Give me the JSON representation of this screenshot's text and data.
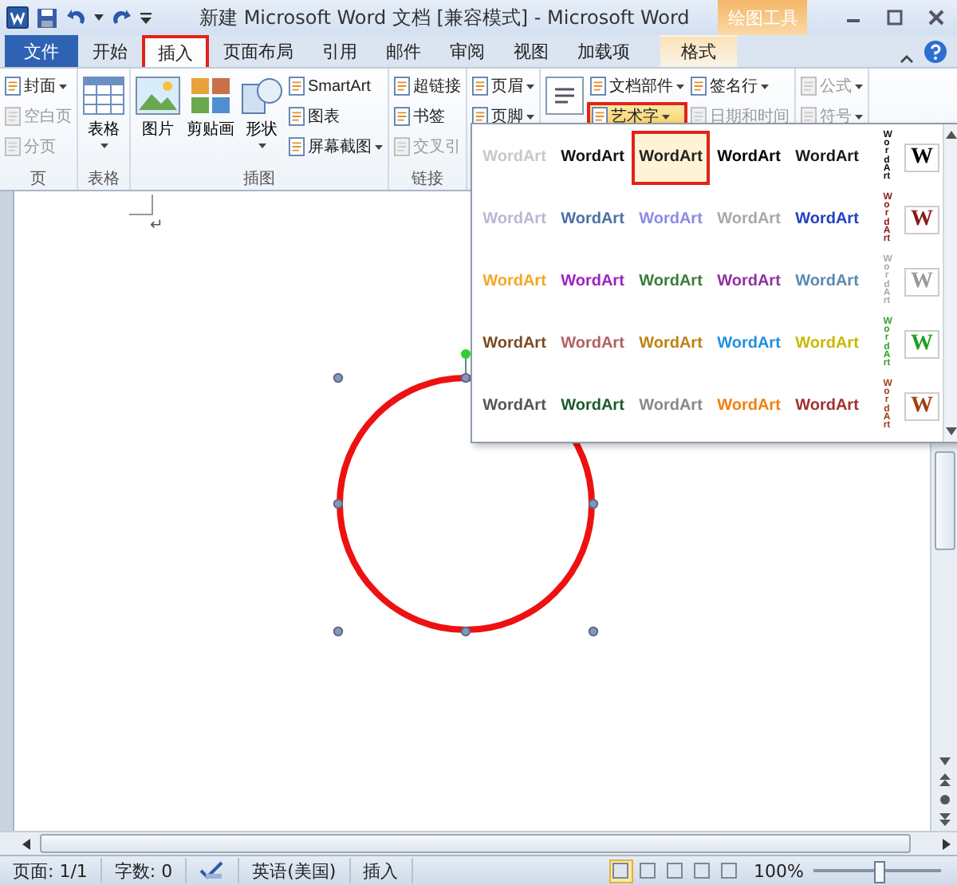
{
  "title_bar": {
    "title": "新建 Microsoft Word 文档 [兼容模式] - Microsoft Word",
    "context_header": "绘图工具"
  },
  "tabs": [
    {
      "label": "文件",
      "kind": "file",
      "selected": false
    },
    {
      "label": "开始",
      "kind": "normal",
      "selected": false
    },
    {
      "label": "插入",
      "kind": "normal",
      "selected": true
    },
    {
      "label": "页面布局",
      "kind": "normal",
      "selected": false
    },
    {
      "label": "引用",
      "kind": "normal",
      "selected": false
    },
    {
      "label": "邮件",
      "kind": "normal",
      "selected": false
    },
    {
      "label": "审阅",
      "kind": "normal",
      "selected": false
    },
    {
      "label": "视图",
      "kind": "normal",
      "selected": false
    },
    {
      "label": "加载项",
      "kind": "normal",
      "selected": false
    },
    {
      "label": "格式",
      "kind": "context",
      "selected": false
    }
  ],
  "ribbon": {
    "groups": [
      {
        "label": "页",
        "columns": [
          [
            {
              "kind": "small",
              "label": "封面",
              "dropdown": true,
              "disabled": false,
              "open": false
            },
            {
              "kind": "small",
              "label": "空白页",
              "dropdown": false,
              "disabled": true,
              "open": false
            },
            {
              "kind": "small",
              "label": "分页",
              "dropdown": false,
              "disabled": true,
              "open": false
            }
          ]
        ]
      },
      {
        "label": "表格",
        "columns": [
          [
            {
              "kind": "large",
              "label": "表格",
              "dropdown": true,
              "disabled": false,
              "open": false
            }
          ]
        ]
      },
      {
        "label": "插图",
        "columns": [
          [
            {
              "kind": "large",
              "label": "图片",
              "dropdown": false,
              "disabled": false,
              "open": false
            }
          ],
          [
            {
              "kind": "large",
              "label": "剪贴画",
              "dropdown": false,
              "disabled": false,
              "open": false
            }
          ],
          [
            {
              "kind": "large",
              "label": "形状",
              "dropdown": true,
              "disabled": false,
              "open": false
            }
          ],
          [
            {
              "kind": "small",
              "label": "SmartArt",
              "dropdown": false,
              "disabled": false,
              "open": false
            },
            {
              "kind": "small",
              "label": "图表",
              "dropdown": false,
              "disabled": false,
              "open": false
            },
            {
              "kind": "small",
              "label": "屏幕截图",
              "dropdown": true,
              "disabled": false,
              "open": false
            }
          ]
        ]
      },
      {
        "label": "链接",
        "columns": [
          [
            {
              "kind": "small",
              "label": "超链接",
              "dropdown": false,
              "disabled": false,
              "open": false
            },
            {
              "kind": "small",
              "label": "书签",
              "dropdown": false,
              "disabled": false,
              "open": false
            },
            {
              "kind": "small",
              "label": "交叉引",
              "dropdown": false,
              "disabled": true,
              "open": false
            }
          ]
        ]
      },
      {
        "columns": [
          [
            {
              "kind": "small",
              "label": "页眉",
              "dropdown": true,
              "disabled": false,
              "open": false
            },
            {
              "kind": "small",
              "label": "页脚",
              "dropdown": true,
              "disabled": false,
              "open": false
            }
          ]
        ]
      },
      {
        "columns": [
          [
            {
              "kind": "large",
              "dropdown": false,
              "disabled": false,
              "open": false
            }
          ],
          [
            {
              "kind": "small",
              "label": "文档部件",
              "dropdown": true,
              "disabled": false,
              "open": false
            },
            {
              "kind": "small",
              "label": "艺术字",
              "dropdown": true,
              "disabled": false,
              "open": true
            }
          ],
          [
            {
              "kind": "small",
              "label": "签名行",
              "dropdown": true,
              "disabled": false,
              "open": false
            },
            {
              "kind": "small",
              "label": "日期和时间",
              "dropdown": false,
              "disabled": true,
              "open": false
            }
          ]
        ]
      },
      {
        "columns": [
          [
            {
              "kind": "small",
              "label": "公式",
              "dropdown": true,
              "disabled": true,
              "open": false
            },
            {
              "kind": "small",
              "label": "符号",
              "dropdown": true,
              "disabled": true,
              "open": false
            }
          ]
        ]
      }
    ]
  },
  "document": {
    "paragraph_mark": "↵"
  },
  "wordart_gallery": {
    "rows": [
      [
        {
          "kind": "horizontal",
          "text": "WordArt",
          "color": "#c8c8c8",
          "selected": false
        },
        {
          "kind": "horizontal",
          "text": "WordArt",
          "color": "#111111",
          "selected": false
        },
        {
          "kind": "horizontal",
          "text": "WordArt",
          "color": "#222222",
          "selected": true
        },
        {
          "kind": "horizontal",
          "text": "WordArt",
          "color": "#000000",
          "selected": false
        },
        {
          "kind": "horizontal",
          "text": "WordArt",
          "color": "#1a1a1a",
          "selected": false
        },
        {
          "kind": "vertical",
          "text": "WordArt",
          "color": "#111111",
          "selected": false
        },
        {
          "kind": "thumbnail",
          "text": "W",
          "color": "#000000",
          "selected": false
        }
      ],
      [
        {
          "kind": "horizontal",
          "text": "WordArt",
          "color": "#b8b8d0",
          "selected": false
        },
        {
          "kind": "horizontal",
          "text": "WordArt",
          "color": "#4a6fa5",
          "selected": false
        },
        {
          "kind": "horizontal",
          "text": "WordArt",
          "color": "#8a8ae6",
          "selected": false
        },
        {
          "kind": "horizontal",
          "text": "WordArt",
          "color": "#a8a8a8",
          "selected": false
        },
        {
          "kind": "horizontal",
          "text": "WordArt",
          "color": "#2040c0",
          "selected": false
        },
        {
          "kind": "vertical",
          "text": "WordArt",
          "color": "#8b1a1a",
          "selected": false
        },
        {
          "kind": "thumbnail",
          "text": "W",
          "color": "#8b1a1a",
          "selected": false
        }
      ],
      [
        {
          "kind": "horizontal",
          "text": "WordArt",
          "color": "#f5a623",
          "selected": false
        },
        {
          "kind": "horizontal",
          "text": "WordArt",
          "color": "#a020c0",
          "selected": false
        },
        {
          "kind": "horizontal",
          "text": "WordArt",
          "color": "#3a7a3a",
          "selected": false
        },
        {
          "kind": "horizontal",
          "text": "WordArt",
          "color": "#9030a0",
          "selected": false
        },
        {
          "kind": "horizontal",
          "text": "WordArt",
          "color": "#5a8ab0",
          "selected": false
        },
        {
          "kind": "vertical",
          "text": "WordArt",
          "color": "#aaaaaa",
          "selected": false
        },
        {
          "kind": "thumbnail",
          "text": "W",
          "color": "#999999",
          "selected": false
        }
      ],
      [
        {
          "kind": "horizontal",
          "text": "WordArt",
          "color": "#7a4a20",
          "selected": false
        },
        {
          "kind": "horizontal",
          "text": "WordArt",
          "color": "#b06060",
          "selected": false
        },
        {
          "kind": "horizontal",
          "text": "WordArt",
          "color": "#c08010",
          "selected": false
        },
        {
          "kind": "horizontal",
          "text": "WordArt",
          "color": "#2090e0",
          "selected": false
        },
        {
          "kind": "horizontal",
          "text": "WordArt",
          "color": "#c8b800",
          "selected": false
        },
        {
          "kind": "vertical",
          "text": "WordArt",
          "color": "#30a030",
          "selected": false
        },
        {
          "kind": "thumbnail",
          "text": "W",
          "color": "#20a020",
          "selected": false
        }
      ],
      [
        {
          "kind": "horizontal",
          "text": "WordArt",
          "color": "#555555",
          "selected": false
        },
        {
          "kind": "horizontal",
          "text": "WordArt",
          "color": "#1a5a2a",
          "selected": false
        },
        {
          "kind": "horizontal",
          "text": "WordArt",
          "color": "#888888",
          "selected": false
        },
        {
          "kind": "horizontal",
          "text": "WordArt",
          "color": "#f08010",
          "selected": false
        },
        {
          "kind": "horizontal",
          "text": "WordArt",
          "color": "#a03030",
          "selected": false
        },
        {
          "kind": "vertical",
          "text": "WordArt",
          "color": "#a0401a",
          "selected": false
        },
        {
          "kind": "thumbnail",
          "text": "W",
          "color": "#a04010",
          "selected": false
        }
      ]
    ]
  },
  "status_bar": {
    "items": [
      {
        "kind": "text",
        "text": "页面: 1/1"
      },
      {
        "kind": "text",
        "text": "字数: 0"
      },
      {
        "kind": "proofing"
      },
      {
        "kind": "text",
        "text": "英语(美国)"
      },
      {
        "kind": "text",
        "text": "插入"
      }
    ],
    "view_buttons": [
      {
        "selected": true
      },
      {
        "selected": false
      },
      {
        "selected": false
      },
      {
        "selected": false
      },
      {
        "selected": false
      }
    ],
    "zoom": "100%",
    "zoom_slider": {
      "level": 0.5
    }
  }
}
